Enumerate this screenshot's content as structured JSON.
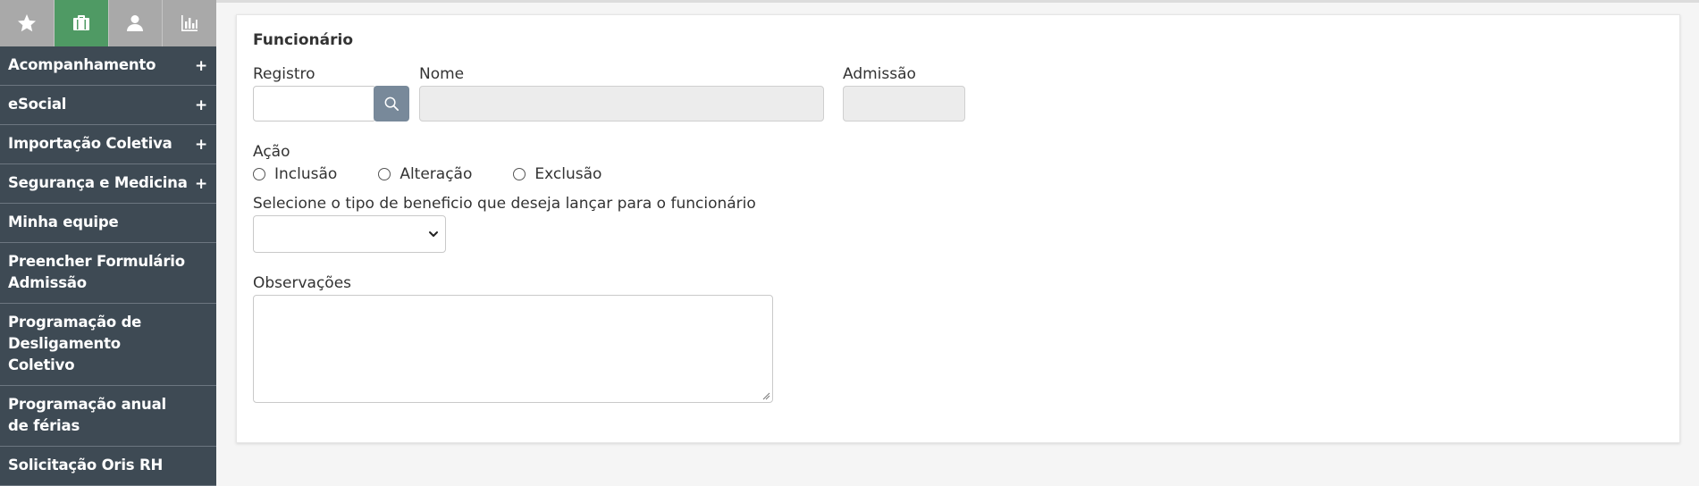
{
  "sidebar": {
    "tabs": [
      {
        "icon": "star-icon",
        "active": false
      },
      {
        "icon": "briefcase-icon",
        "active": true
      },
      {
        "icon": "user-icon",
        "active": false
      },
      {
        "icon": "bar-chart-icon",
        "active": false
      }
    ],
    "items": [
      {
        "label": "Acompanhamento",
        "expandable": "+"
      },
      {
        "label": "eSocial",
        "expandable": "+"
      },
      {
        "label": "Importação Coletiva",
        "expandable": "+"
      },
      {
        "label": "Segurança e Medicina",
        "expandable": "+"
      },
      {
        "label": "Minha equipe"
      },
      {
        "label": "Preencher Formulário Admissão"
      },
      {
        "label": "Programação de Desligamento Coletivo"
      },
      {
        "label": "Programação anual de férias"
      },
      {
        "label": "Solicitação Oris RH"
      }
    ]
  },
  "form": {
    "section_title": "Funcionário",
    "registro_label": "Registro",
    "registro_value": "",
    "nome_label": "Nome",
    "nome_value": "",
    "admissao_label": "Admissão",
    "admissao_value": "",
    "acao_label": "Ação",
    "acao_options": [
      "Inclusão",
      "Alteração",
      "Exclusão"
    ],
    "beneficio_label": "Selecione o tipo de beneficio que deseja lançar para o funcionário",
    "beneficio_selected": "",
    "observacoes_label": "Observações",
    "observacoes_value": ""
  },
  "colors": {
    "sidebar_item_bg": "#3e4a54",
    "tab_active": "#4f9a64",
    "tab_inactive": "#a9a9a9",
    "search_button": "#78899a"
  }
}
